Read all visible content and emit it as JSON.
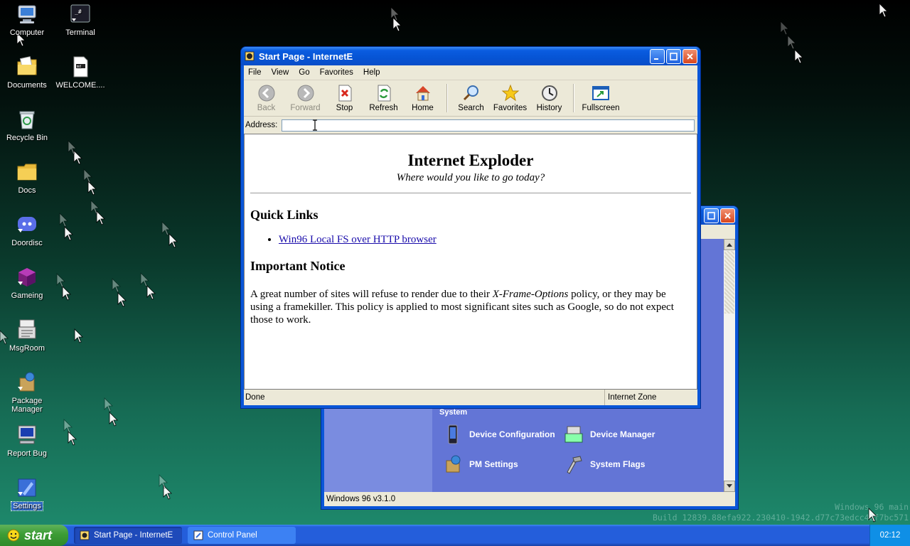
{
  "desktop": {
    "icons": [
      {
        "label": "Computer",
        "icon": "computer-icon"
      },
      {
        "label": "Terminal",
        "icon": "terminal-icon"
      },
      {
        "label": "Documents",
        "icon": "documents-icon"
      },
      {
        "label": "WELCOME....",
        "icon": "text-file-icon"
      },
      {
        "label": "Recycle Bin",
        "icon": "recycle-bin-icon"
      },
      {
        "label": "Docs",
        "icon": "folder-icon"
      },
      {
        "label": "Doordisc",
        "icon": "doordisc-icon"
      },
      {
        "label": "Gameing",
        "icon": "gameing-icon"
      },
      {
        "label": "MsgRoom",
        "icon": "msgroom-icon"
      },
      {
        "label": "Package Manager",
        "icon": "package-manager-icon"
      },
      {
        "label": "Report Bug",
        "icon": "report-bug-icon"
      },
      {
        "label": "Settings",
        "icon": "settings-icon"
      }
    ],
    "watermark": {
      "line1": "Windows 96 main",
      "line2": "Build 12839.88efa922.230410-1942.d77c73edcc42f7bc571"
    }
  },
  "browser": {
    "title": "Start Page - InternetE",
    "menu": [
      "File",
      "View",
      "Go",
      "Favorites",
      "Help"
    ],
    "toolbar": {
      "back": "Back",
      "forward": "Forward",
      "stop": "Stop",
      "refresh": "Refresh",
      "home": "Home",
      "search": "Search",
      "favorites": "Favorites",
      "history": "History",
      "fullscreen": "Fullscreen"
    },
    "address_label": "Address:",
    "address_value": "",
    "page": {
      "heading": "Internet Exploder",
      "tagline": "Where would you like to go today?",
      "quick_links_heading": "Quick Links",
      "quick_links": [
        "Win96 Local FS over HTTP browser"
      ],
      "notice_heading": "Important Notice",
      "notice_pre": "A great number of sites will refuse to render due to their ",
      "notice_em": "X-Frame-Options",
      "notice_post": " policy, or they may be using a framekiller. This policy is applied to most significant sites such as Google, so do not expect those to work."
    },
    "status": "Done",
    "zone": "Internet Zone"
  },
  "control_panel": {
    "section_label": "System",
    "items": [
      "Device Configuration",
      "Device Manager",
      "PM Settings",
      "System Flags"
    ],
    "status": "Windows 96 v3.1.0"
  },
  "taskbar": {
    "start_label": "start",
    "tasks": [
      "Start Page - InternetE",
      "Control Panel"
    ],
    "clock": "02:12"
  },
  "colors": {
    "titlebar": "#0a56d8",
    "taskbar": "#245edb",
    "start": "#3c9c35",
    "cp_background": "#6375d6"
  }
}
